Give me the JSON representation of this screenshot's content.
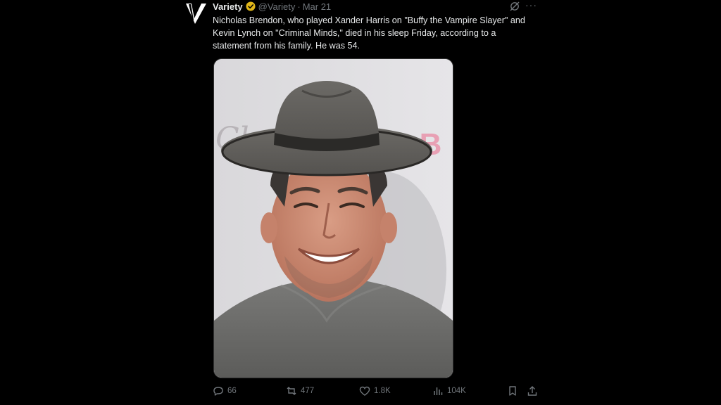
{
  "tweet": {
    "author": {
      "name": "Variety",
      "handle": "@Variety",
      "separator": "·",
      "date": "Mar 21",
      "avatar_letter": "V",
      "verified_icon": "verified-badge-gold"
    },
    "text": "Nicholas Brendon, who played Xander Harris on \"Buffy the Vampire Slayer\" and Kevin Lynch on \"Criminal Minds,\" died in his sleep Friday, according to a statement from his family. He was 54.",
    "media": {
      "backdrop_text_left": "Cl",
      "backdrop_text_right": "he B"
    },
    "menu_icons": {
      "grok": "grok-icon",
      "more": "more-icon",
      "more_glyph": "···"
    },
    "actions": {
      "replies": "66",
      "reposts": "477",
      "likes": "1.8K",
      "views": "104K"
    }
  },
  "colors": {
    "background": "#000000",
    "text_primary": "#e7e9ea",
    "text_secondary": "#71767b",
    "verified_gold": "#e2b719"
  }
}
